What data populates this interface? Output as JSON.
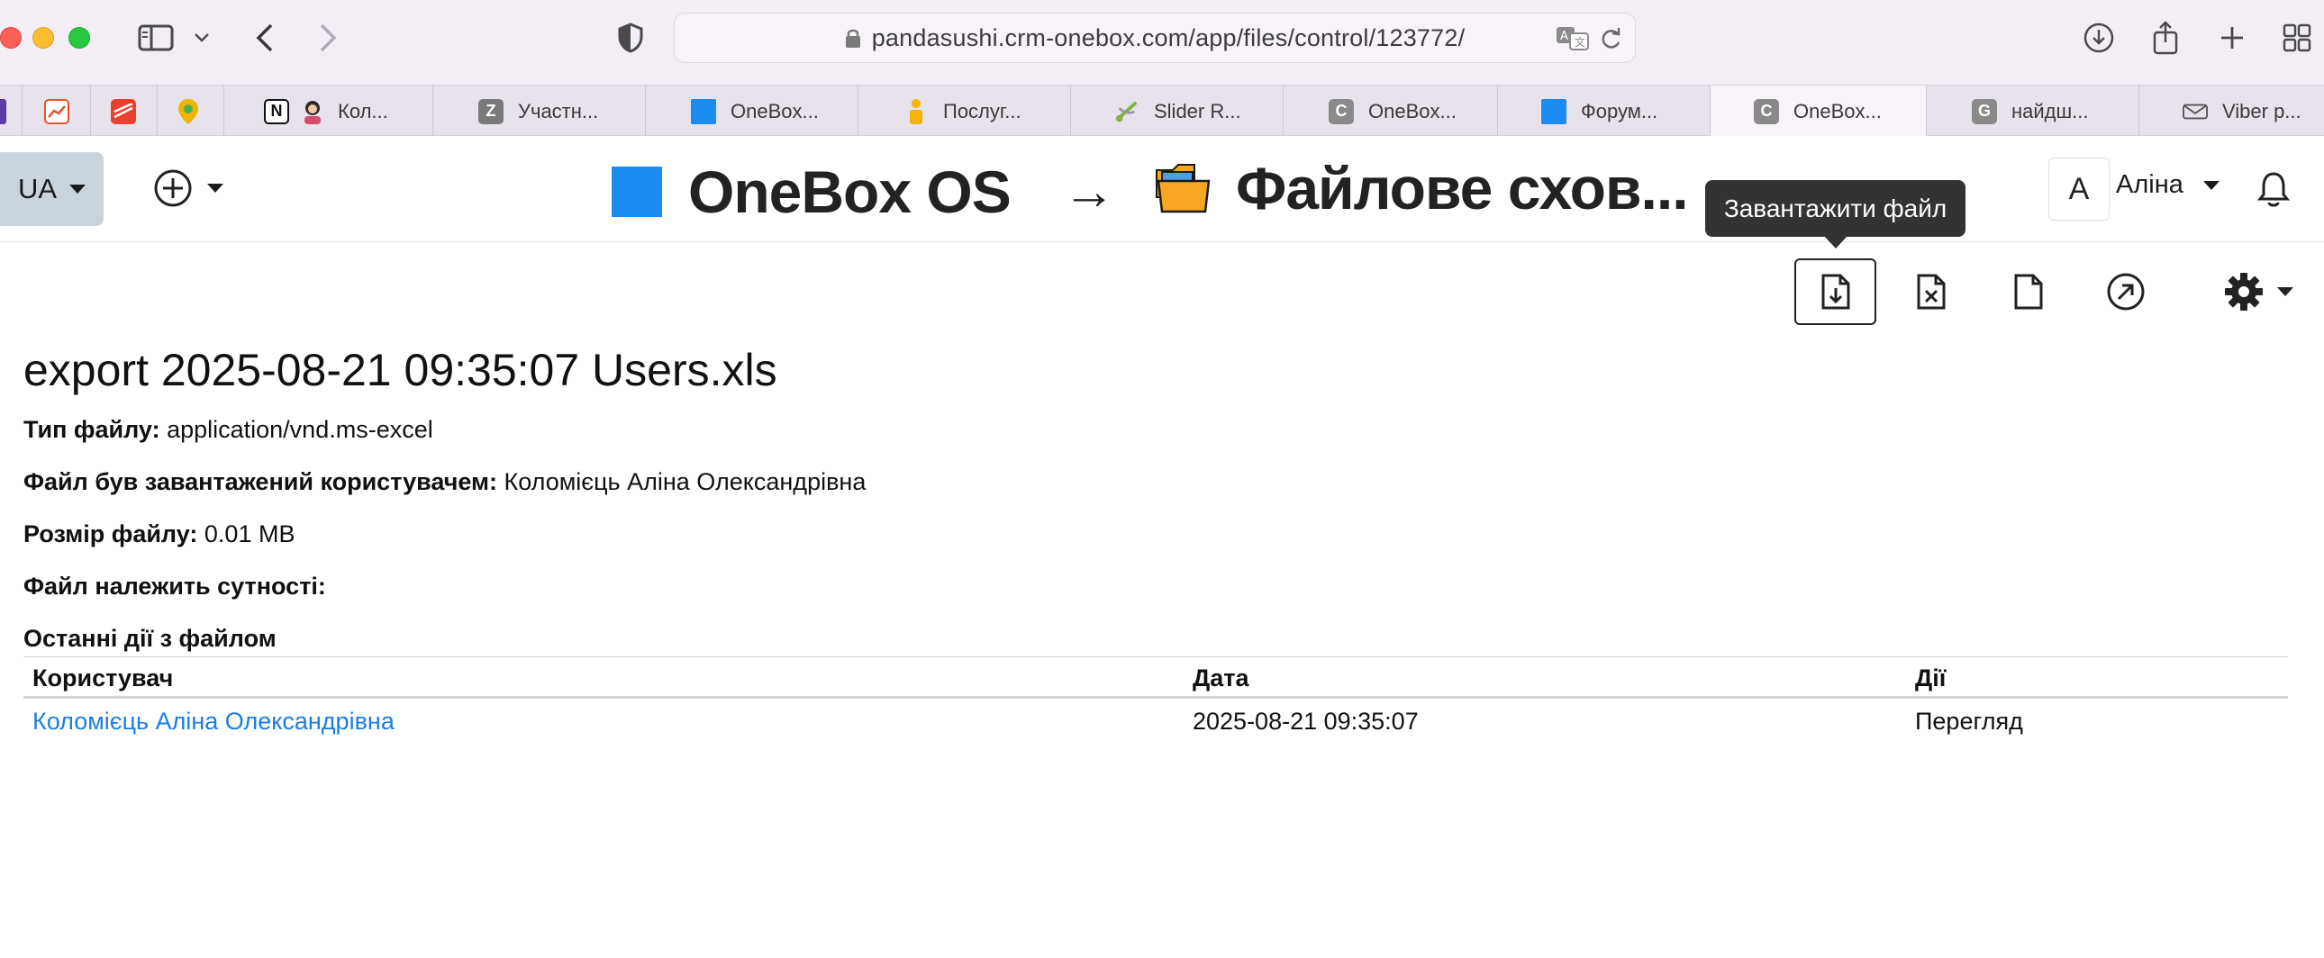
{
  "browser": {
    "url": "pandasushi.crm-onebox.com/app/files/control/123772/",
    "tabs": [
      {
        "label": "",
        "favicon_color": "#5b3aa6"
      },
      {
        "label": "",
        "favicon_color": "#e8502e"
      },
      {
        "label": "",
        "favicon_color": "#e8412e"
      },
      {
        "label": "",
        "favicon_color": "#f0b400"
      },
      {
        "label": "Кол...",
        "favicon_color": "#111111"
      },
      {
        "label": "Участн...",
        "favicon_letter": "Z",
        "favicon_color": "#7a7a7a"
      },
      {
        "label": "OneBox...",
        "favicon_color": "#1b8cf2"
      },
      {
        "label": "Послуг...",
        "favicon_color": "#f5b400"
      },
      {
        "label": "Slider R...",
        "favicon_color": "#7cb342"
      },
      {
        "label": "OneBox...",
        "favicon_letter": "C",
        "favicon_color": "#8a8a8a"
      },
      {
        "label": "Форум...",
        "favicon_color": "#1b8cf2"
      },
      {
        "label": "OneBox...",
        "favicon_letter": "C",
        "favicon_color": "#8a8a8a"
      },
      {
        "label": "найдш...",
        "favicon_letter": "G",
        "favicon_color": "#8a8a8a"
      },
      {
        "label": "Viber p...",
        "favicon_color": "#7360f2"
      }
    ]
  },
  "header": {
    "lang": "UA",
    "brand": "OneBox OS",
    "arrow": "→",
    "section": "Файлове схов...",
    "user_initial": "A",
    "user_name": "Аліна"
  },
  "toolbar": {
    "tooltip": "Завантажити файл",
    "icons": [
      "download-file-icon",
      "delete-file-icon",
      "file-icon",
      "open-link-icon",
      "gear-icon"
    ]
  },
  "file": {
    "title": "export 2025-08-21 09:35:07 Users.xls",
    "type_label": "Тип файлу:",
    "type_value": "application/vnd.ms-excel",
    "uploader_label": "Файл був завантажений користувачем:",
    "uploader_value": "Коломієць Аліна Олександрівна",
    "size_label": "Розмір файлу:",
    "size_value": "0.01 MB",
    "entity_label": "Файл належить сутності:",
    "recent_label": "Останні дії з файлом"
  },
  "table": {
    "headers": [
      "Користувач",
      "Дата",
      "Дії"
    ],
    "rows": [
      {
        "user": "Коломієць Аліна Олександрівна",
        "date": "2025-08-21 09:35:07",
        "action": "Перегляд"
      }
    ]
  }
}
